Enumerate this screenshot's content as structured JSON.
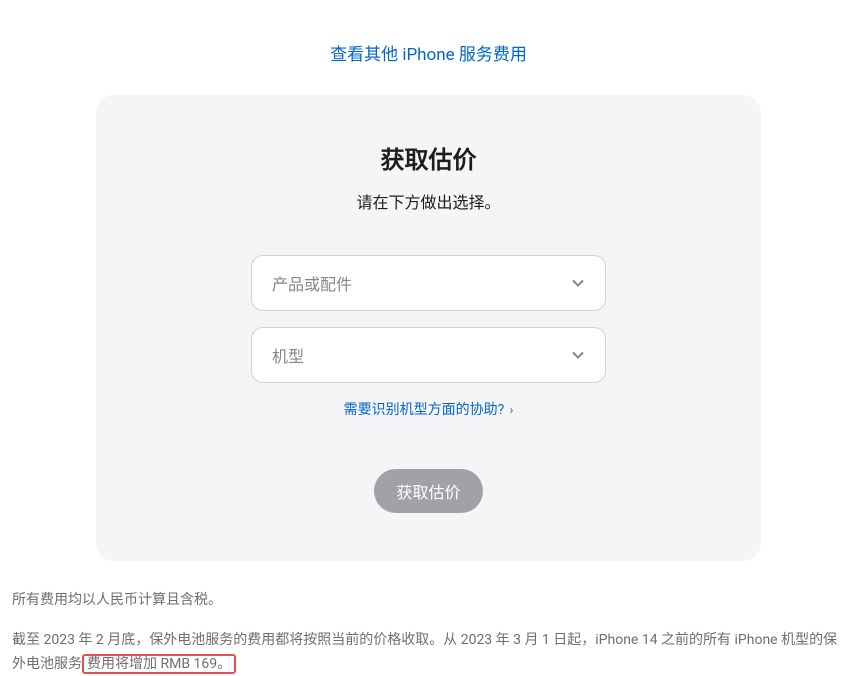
{
  "topLink": {
    "label": "查看其他 iPhone 服务费用"
  },
  "card": {
    "title": "获取估价",
    "subtitle": "请在下方做出选择。",
    "select1": {
      "placeholder": "产品或配件"
    },
    "select2": {
      "placeholder": "机型"
    },
    "help": {
      "label": "需要识别机型方面的协助?",
      "arrow": "›"
    },
    "button": {
      "label": "获取估价"
    }
  },
  "notes": {
    "line1": "所有费用均以人民币计算且含税。",
    "line2_part1": "截至 2023 年 2 月底，保外电池服务的费用都将按照当前的价格收取。从 2023 年 3 月 1 日起，iPhone 14 之前的所有 iPhone 机型的保外电池服务",
    "line2_highlight": "费用将增加 RMB 169。"
  }
}
